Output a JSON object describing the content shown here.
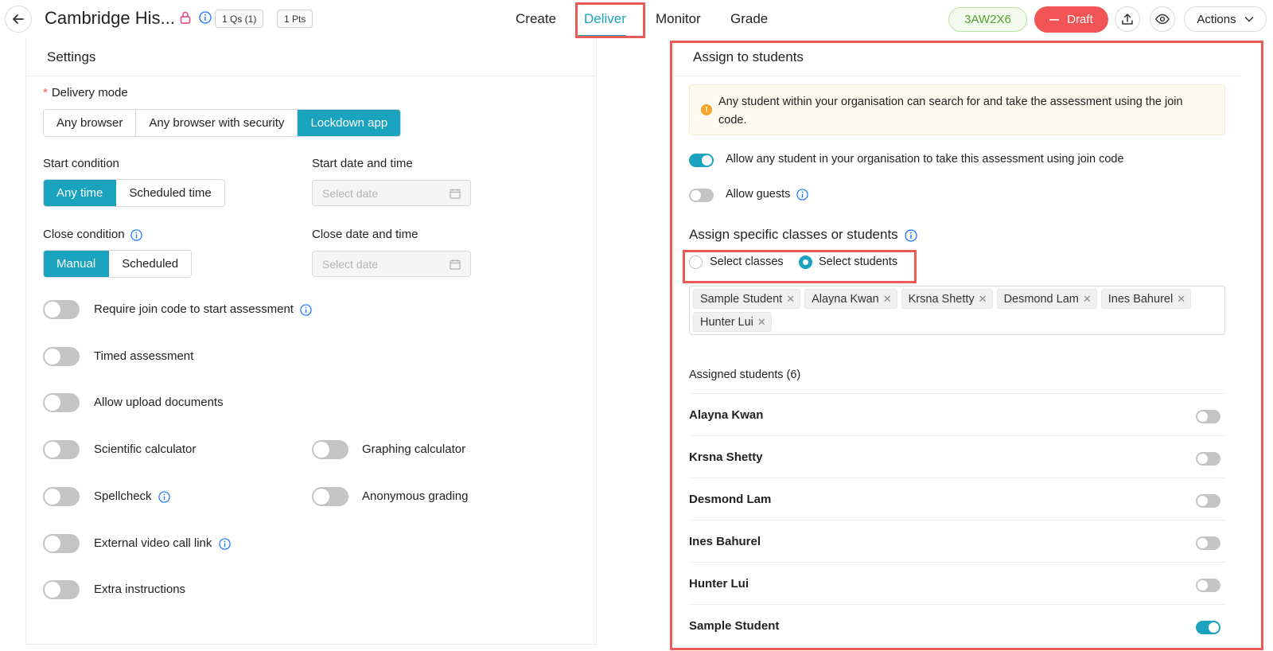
{
  "header": {
    "title": "Cambridge His...",
    "questions_pill": "1 Qs (1)",
    "points_pill": "1 Pts",
    "tabs": [
      {
        "label": "Create"
      },
      {
        "label": "Deliver"
      },
      {
        "label": "Monitor"
      },
      {
        "label": "Grade"
      }
    ],
    "active_tab": "Deliver",
    "join_code": "3AW2X6",
    "status_button": "Draft",
    "actions_label": "Actions",
    "icons": [
      "back-arrow-icon",
      "lock-icon",
      "info-icon",
      "upload-icon",
      "eye-icon",
      "chevron-down-icon"
    ]
  },
  "settings": {
    "heading": "Settings",
    "delivery_mode": {
      "label": "Delivery mode",
      "options": [
        "Any browser",
        "Any browser with security",
        "Lockdown app"
      ],
      "selected": "Lockdown app"
    },
    "start_condition": {
      "label": "Start condition",
      "options": [
        "Any time",
        "Scheduled time"
      ],
      "selected": "Any time"
    },
    "start_datetime": {
      "label": "Start date and time",
      "placeholder": "Select date"
    },
    "close_condition": {
      "label": "Close condition",
      "options": [
        "Manual",
        "Scheduled"
      ],
      "selected": "Manual"
    },
    "close_datetime": {
      "label": "Close date and time",
      "placeholder": "Select date"
    },
    "toggles": {
      "join_code": {
        "label": "Require join code to start assessment",
        "on": false
      },
      "timed": {
        "label": "Timed assessment",
        "on": false
      },
      "upload": {
        "label": "Allow upload documents",
        "on": false
      },
      "sci_calc": {
        "label": "Scientific calculator",
        "on": false
      },
      "graph_calc": {
        "label": "Graphing calculator",
        "on": false
      },
      "spellcheck": {
        "label": "Spellcheck",
        "on": false
      },
      "anon_grading": {
        "label": "Anonymous grading",
        "on": false
      },
      "video_link": {
        "label": "External video call link",
        "on": false
      },
      "extra_instructions": {
        "label": "Extra instructions",
        "on": false
      }
    }
  },
  "assign": {
    "heading": "Assign to students",
    "notice": "Any student within your organisation can search for and take the assessment using the join code.",
    "allow_org": {
      "label": "Allow any student in your organisation to take this assessment using join code",
      "on": true
    },
    "allow_guests": {
      "label": "Allow guests",
      "on": false
    },
    "specific_heading": "Assign specific classes or students",
    "radio_classes": "Select classes",
    "radio_students": "Select students",
    "selected_radio": "Select students",
    "tags": [
      "Sample Student",
      "Alayna Kwan",
      "Krsna Shetty",
      "Desmond Lam",
      "Ines Bahurel",
      "Hunter Lui"
    ],
    "assigned_heading": "Assigned students (6)",
    "students": [
      {
        "name": "Alayna Kwan",
        "on": false
      },
      {
        "name": "Krsna Shetty",
        "on": false
      },
      {
        "name": "Desmond Lam",
        "on": false
      },
      {
        "name": "Ines Bahurel",
        "on": false
      },
      {
        "name": "Hunter Lui",
        "on": false
      },
      {
        "name": "Sample Student",
        "on": true
      }
    ]
  },
  "colors": {
    "accent": "#1aa3bf",
    "draft": "#f05454",
    "code_badge": "#52a32c",
    "highlight": "#ec5a55"
  }
}
